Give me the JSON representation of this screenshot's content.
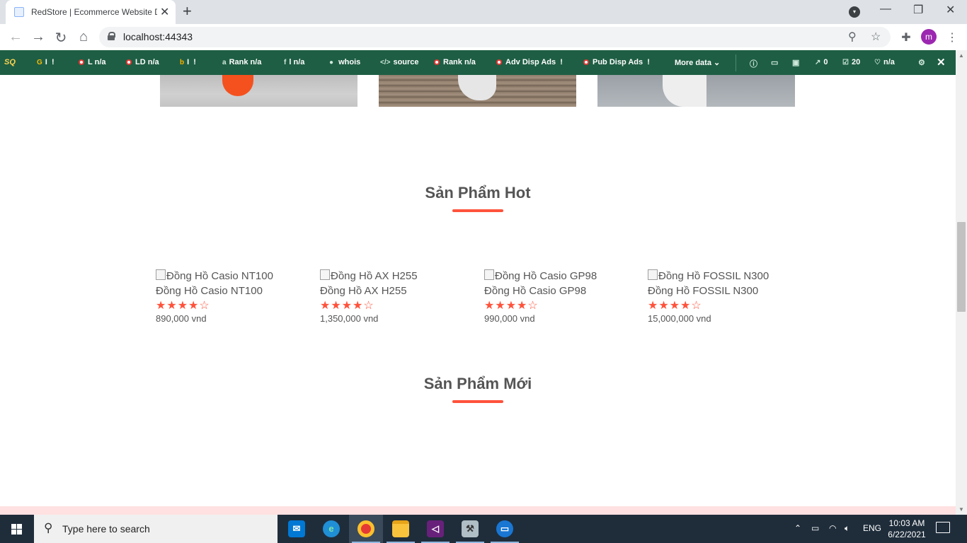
{
  "browser": {
    "tab_title": "RedStore | Ecommerce Website D",
    "url": "localhost:44343",
    "profile_initial": "m"
  },
  "seoquake": {
    "logo": "SQ",
    "items": [
      {
        "icon": "google-icon",
        "label": "I",
        "value": "!"
      },
      {
        "icon": "dot-icon",
        "label": "L",
        "value": "n/a"
      },
      {
        "icon": "dot-icon",
        "label": "LD",
        "value": "n/a"
      },
      {
        "icon": "bing-icon",
        "label": "I",
        "value": "!"
      },
      {
        "icon": "alexa-icon",
        "label": "Rank",
        "value": "n/a"
      },
      {
        "icon": "facebook-icon",
        "label": "l",
        "value": "n/a"
      },
      {
        "icon": "person-icon",
        "label": "whois",
        "value": ""
      },
      {
        "icon": "code-icon",
        "label": "source",
        "value": ""
      },
      {
        "icon": "dot-icon",
        "label": "Rank",
        "value": "n/a"
      },
      {
        "icon": "dot-icon",
        "label": "Adv Disp Ads",
        "value": "!"
      },
      {
        "icon": "dot-icon",
        "label": "Pub Disp Ads",
        "value": "!"
      }
    ],
    "more_data": "More data",
    "right_stats": {
      "external_links": "0",
      "internal_links": "20",
      "rank": "n/a"
    }
  },
  "page": {
    "hot_title": "Sản Phẩm Hot",
    "new_title": "Sản Phẩm Mới",
    "products": [
      {
        "alt": "Đồng Hồ Casio NT100",
        "name": "Đồng Hồ Casio NT100",
        "rating": 4,
        "stars": "★★★★☆",
        "price": "890,000 vnd"
      },
      {
        "alt": "Đồng Hồ AX H255",
        "name": "Đồng Hồ AX H255",
        "rating": 4,
        "stars": "★★★★☆",
        "price": "1,350,000 vnd"
      },
      {
        "alt": "Đồng Hồ Casio GP98",
        "name": "Đồng Hồ Casio GP98",
        "rating": 4,
        "stars": "★★★★☆",
        "price": "990,000 vnd"
      },
      {
        "alt": "Đồng Hồ FOSSIL N300",
        "name": "Đồng Hồ FOSSIL N300",
        "rating": 4,
        "stars": "★★★★☆",
        "price": "15,000,000 vnd"
      }
    ]
  },
  "taskbar": {
    "search_placeholder": "Type here to search",
    "language": "ENG",
    "time": "10:03 AM",
    "date": "6/22/2021"
  },
  "colors": {
    "accent": "#ff523b",
    "seobar": "#1e5e44",
    "taskbar": "#1f2d3b"
  }
}
